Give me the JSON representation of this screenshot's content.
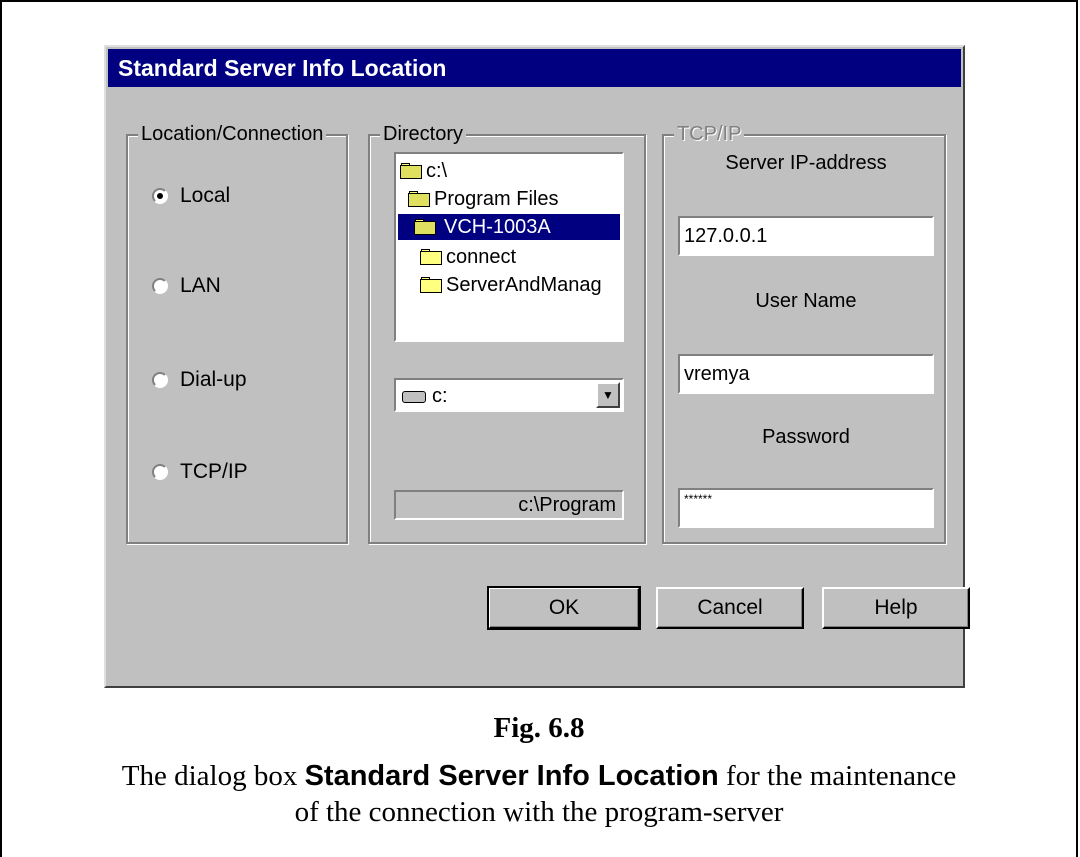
{
  "dialog": {
    "title": "Standard Server Info Location",
    "location_group": {
      "title": "Location/Connection",
      "options": [
        {
          "label": "Local",
          "checked": true
        },
        {
          "label": "LAN",
          "checked": false
        },
        {
          "label": "Dial-up",
          "checked": false
        },
        {
          "label": "TCP/IP",
          "checked": false
        }
      ]
    },
    "directory_group": {
      "title": "Directory",
      "tree": [
        {
          "label": "c:\\",
          "icon": "open-folder-icon",
          "selected": false
        },
        {
          "label": "Program Files",
          "icon": "open-folder-icon",
          "selected": false
        },
        {
          "label": "VCH-1003A",
          "icon": "open-folder-icon",
          "selected": true
        },
        {
          "label": "connect",
          "icon": "folder-icon",
          "selected": false
        },
        {
          "label": "ServerAndManag",
          "icon": "folder-icon",
          "selected": false
        }
      ],
      "drive_value": "c:",
      "path_value": "c:\\Program"
    },
    "tcpip_group": {
      "title": "TCP/IP",
      "ip_label": "Server IP-address",
      "ip_value": "127.0.0.1",
      "user_label": "User Name",
      "user_value": "vremya",
      "password_label": "Password",
      "password_value": "******"
    },
    "buttons": {
      "ok": "OK",
      "cancel": "Cancel",
      "help": "Help"
    }
  },
  "caption": {
    "figure": "Fig. 6.8",
    "prefix": "The dialog box ",
    "bold": "Standard Server Info Location",
    "line1_suffix": " for the maintenance",
    "line2": "of the connection with the program-server"
  }
}
